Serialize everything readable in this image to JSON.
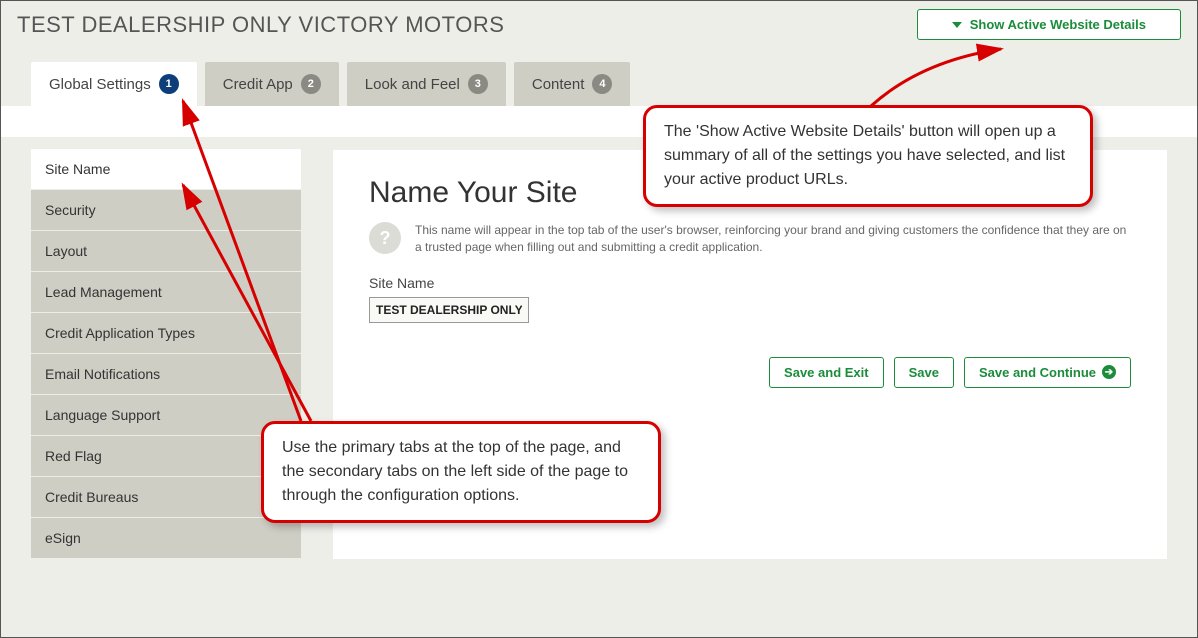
{
  "header": {
    "title": "TEST DEALERSHIP ONLY VICTORY MOTORS",
    "show_details_label": "Show Active Website Details"
  },
  "tabs": [
    {
      "label": "Global Settings",
      "num": "1",
      "active": true
    },
    {
      "label": "Credit App",
      "num": "2",
      "active": false
    },
    {
      "label": "Look and Feel",
      "num": "3",
      "active": false
    },
    {
      "label": "Content",
      "num": "4",
      "active": false
    }
  ],
  "sidebar": {
    "items": [
      "Site Name",
      "Security",
      "Layout",
      "Lead Management",
      "Credit Application Types",
      "Email Notifications",
      "Language Support",
      "Red Flag",
      "Credit Bureaus",
      "eSign"
    ]
  },
  "panel": {
    "heading": "Name Your Site",
    "help_glyph": "?",
    "help_text": "This name will appear in the top tab of the user's browser, reinforcing your brand and giving customers the confidence that they are on a trusted page when filling out and submitting a credit application.",
    "field_label": "Site Name",
    "field_value": "TEST DEALERSHIP ONLY V",
    "buttons": {
      "save_exit": "Save and Exit",
      "save": "Save",
      "save_continue": "Save and Continue"
    }
  },
  "callouts": {
    "c1": "The 'Show Active Website Details' button will open up a summary of all of the settings you have selected, and list your active product URLs.",
    "c2": "Use the primary tabs at the top of the page, and the secondary tabs on the left side of the page to through the configuration options."
  }
}
